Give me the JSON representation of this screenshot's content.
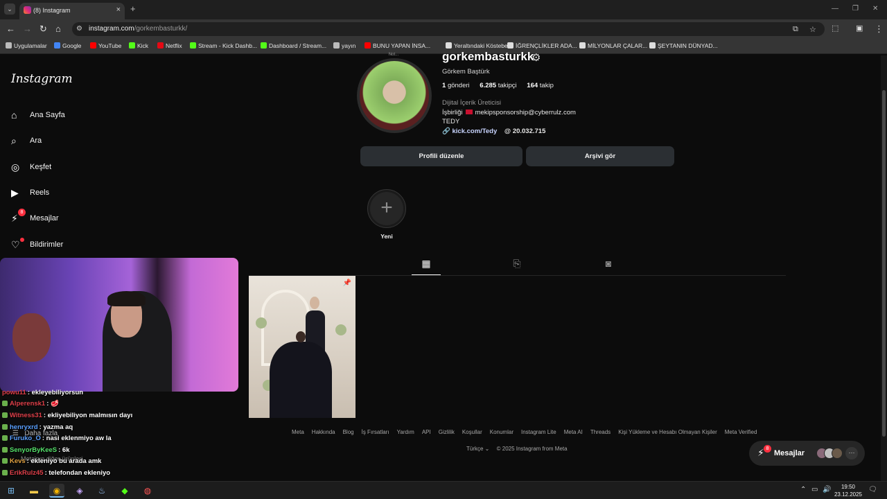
{
  "browser": {
    "tab_title": "(8) Instagram",
    "url_host": "instagram.com",
    "url_path": "/gorkembasturkk/",
    "bookmarks": [
      {
        "label": "Uygulamalar",
        "color": "#bbbbbb"
      },
      {
        "label": "Google",
        "color": "#4285f4"
      },
      {
        "label": "YouTube",
        "color": "#ff0000"
      },
      {
        "label": "Kick",
        "color": "#53fc18"
      },
      {
        "label": "Netflix",
        "color": "#e50914"
      },
      {
        "label": "Stream - Kick Dashb...",
        "color": "#53fc18"
      },
      {
        "label": "Dashboard / Stream...",
        "color": "#53fc18"
      },
      {
        "label": "yayın",
        "color": "#bbbbbb"
      },
      {
        "label": "BUNU YAPAN İNSA...",
        "color": "#ff0000"
      },
      {
        "label": "Yeraltındaki Köstebe...",
        "color": "#dddddd"
      },
      {
        "label": "İĞRENÇLİKLER ADA...",
        "color": "#dddddd"
      },
      {
        "label": "MİLYONLAR ÇALAR...",
        "color": "#dddddd"
      },
      {
        "label": "ŞEYTANIN DÜNYAD...",
        "color": "#dddddd"
      }
    ]
  },
  "sidebar": {
    "logo": "Instagram",
    "items": [
      {
        "label": "Ana Sayfa",
        "icon": "home-icon"
      },
      {
        "label": "Ara",
        "icon": "search-icon"
      },
      {
        "label": "Keşfet",
        "icon": "compass-icon"
      },
      {
        "label": "Reels",
        "icon": "reels-icon"
      },
      {
        "label": "Mesajlar",
        "icon": "messenger-icon",
        "badge": "8"
      },
      {
        "label": "Bildirimler",
        "icon": "heart-icon"
      }
    ],
    "more": "Daha fazla",
    "also_from_meta": "Meta'nın diğer ürünleri"
  },
  "profile": {
    "note": "Not...",
    "username": "gorkembasturkk",
    "full_name": "Görkem Baştürk",
    "posts_count": "1",
    "posts_label": "gönderi",
    "followers_count": "6.285",
    "followers_label": "takipçi",
    "following_count": "164",
    "following_label": "takip",
    "category": "Dijital İçerik Üreticisi",
    "bio_collab_label": "İşbirliği",
    "bio_email": "mekipsponsorship@cyberrulz.com",
    "bio_name": "TEDY",
    "link": "kick.com/Tedy",
    "threads_count": "20.032.715",
    "edit_button": "Profili düzenle",
    "archive_button": "Arşivi gör",
    "new_highlight": "Yeni"
  },
  "footer": {
    "links": [
      "Meta",
      "Hakkında",
      "Blog",
      "İş Fırsatları",
      "Yardım",
      "API",
      "Gizlilik",
      "Koşullar",
      "Konumlar",
      "Instagram Lite",
      "Meta AI",
      "Threads",
      "Kişi Yükleme ve Hesabı Olmayan Kişiler",
      "Meta Verified"
    ],
    "language": "Türkçe",
    "copyright": "© 2025 Instagram from Meta"
  },
  "messages_pill": {
    "label": "Mesajlar",
    "badge": "8"
  },
  "chat": [
    {
      "user": "powu11",
      "color": "#e0404a",
      "text": ": ekleyebiliyorsun"
    },
    {
      "user": "Alperensk1",
      "color": "#e0404a",
      "text": ": 🥩"
    },
    {
      "user": "Witness31",
      "color": "#e0404a",
      "text": ": ekliyebiliyon malmısın dayı"
    },
    {
      "user": "henryxrd",
      "color": "#5aa0ff",
      "text": ": yazma aq"
    },
    {
      "user": "Furuko_O",
      "color": "#5aa0ff",
      "text": ": nasi eklenmiyo aw la"
    },
    {
      "user": "SenyorByKeeS",
      "color": "#54e06a",
      "text": ": 6k"
    },
    {
      "user": "Kevs",
      "color": "#e0a040",
      "text": ": ekleniyo bu arada amk"
    },
    {
      "user": "ErikRulz45",
      "color": "#e0404a",
      "text": ": telefondan ekleniyo"
    }
  ],
  "taskbar": {
    "time": "19:50",
    "date": "23.12.2025"
  }
}
